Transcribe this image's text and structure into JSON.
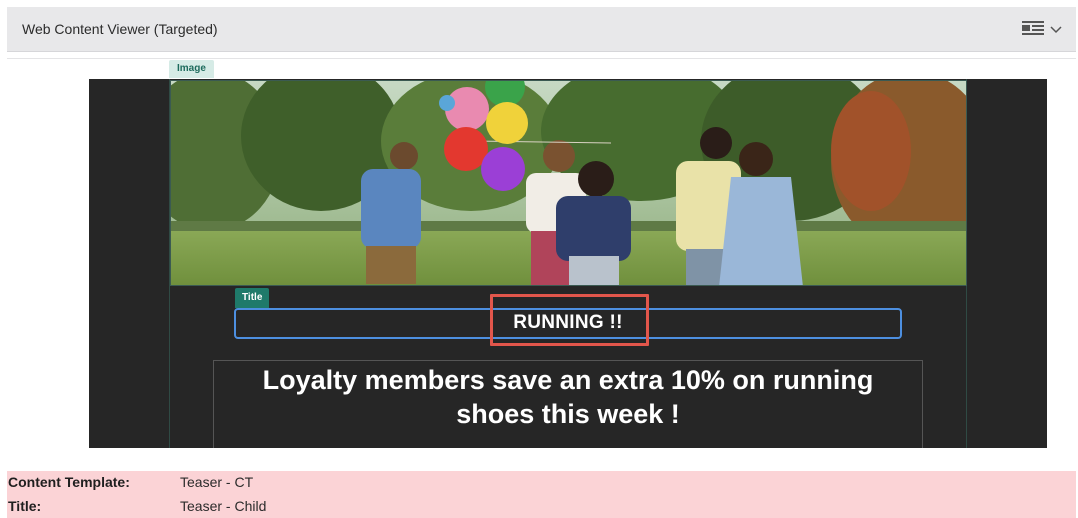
{
  "portlet": {
    "title": "Web Content Viewer (Targeted)",
    "options_icon": "list-options-icon"
  },
  "editor": {
    "image_tag": "Image",
    "title_tag": "Title",
    "title_value": "RUNNING !!",
    "body_text": "Loyalty members save an extra 10% on running shoes this week !"
  },
  "meta": {
    "rows": [
      {
        "label": "Content Template:",
        "value": "Teaser - CT"
      },
      {
        "label": "Title:",
        "value": "Teaser - Child"
      }
    ]
  },
  "colors": {
    "header_bg": "#e8e8ea",
    "stage_bg": "#262626",
    "focus_border": "#4d8fe0",
    "highlight": "#e2564b",
    "meta_bg": "#fbd3d6",
    "tag_dark": "#1f7a6a"
  }
}
